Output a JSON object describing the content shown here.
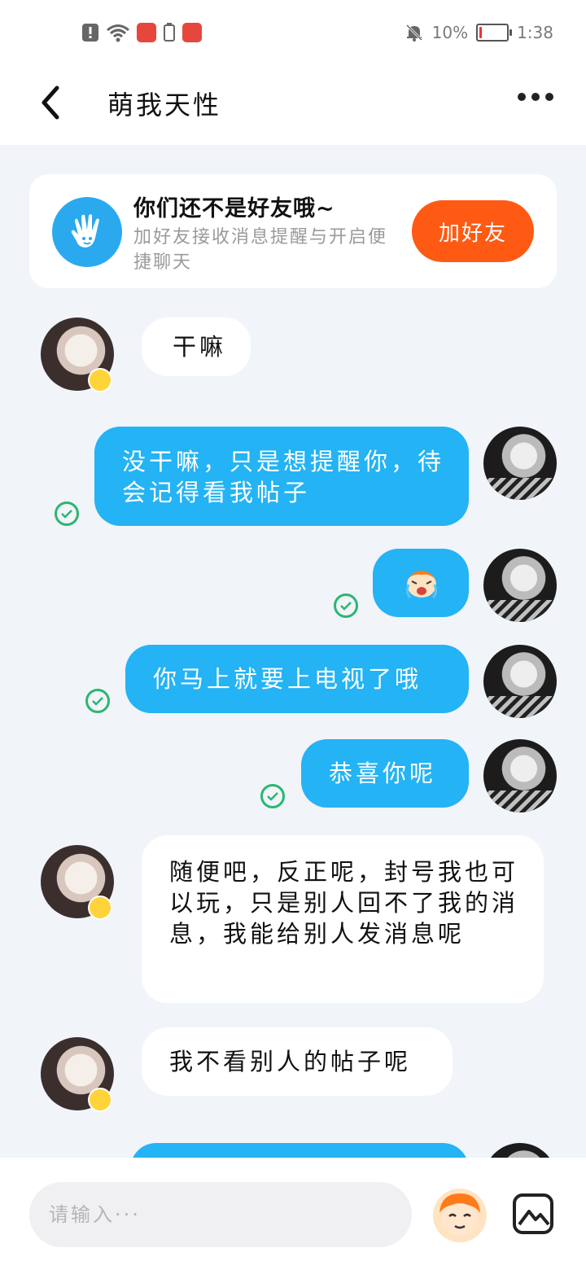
{
  "status_bar": {
    "battery": "10%",
    "time": "1:38",
    "battery_level": 0.1
  },
  "header": {
    "title": "萌我天性"
  },
  "friend_card": {
    "title": "你们还不是好友哦~",
    "subtitle": "加好友接收消息提醒与开启便捷聊天",
    "button": "加好友"
  },
  "messages": [
    {
      "side": "in",
      "text": "干嘛"
    },
    {
      "side": "out",
      "text": "没干嘛，只是想提醒你，待会记得看我帖子"
    },
    {
      "side": "out",
      "type": "sticker",
      "text": ""
    },
    {
      "side": "out",
      "text": "你马上就要上电视了哦"
    },
    {
      "side": "out",
      "text": "恭喜你呢"
    },
    {
      "side": "in",
      "text": "随便吧，反正呢，封号我也可以玩，只是别人回不了我的消息，我能给别人发消息呢"
    },
    {
      "side": "in",
      "text": "我不看别人的帖子呢"
    }
  ],
  "input": {
    "placeholder": "请输入···"
  },
  "colors": {
    "accent_blue": "#24b3f4",
    "accent_orange": "#ff5a14",
    "check_green": "#2bb673"
  }
}
